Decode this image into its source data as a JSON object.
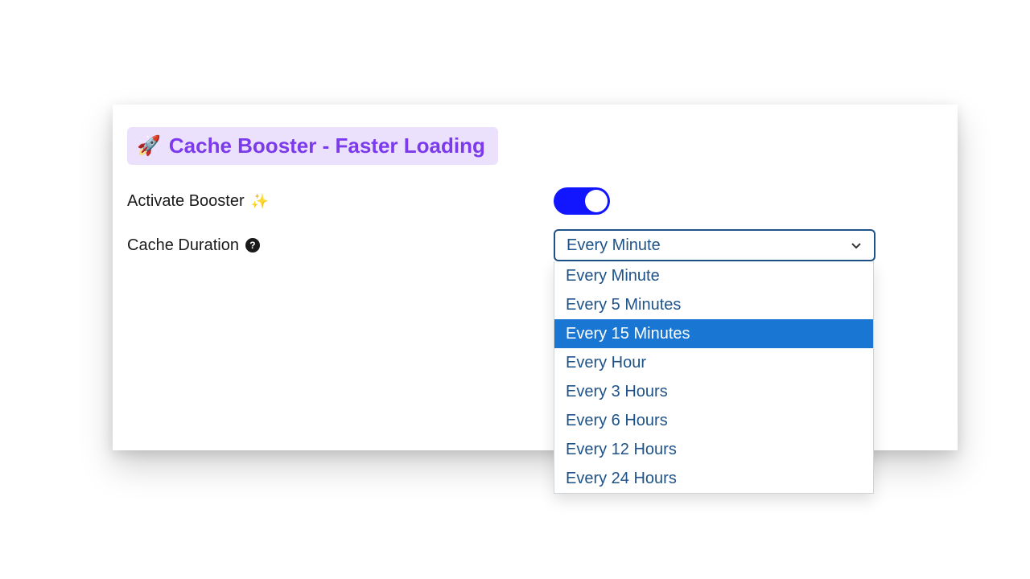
{
  "section": {
    "icon": "🚀",
    "title": "Cache Booster - Faster Loading"
  },
  "rows": {
    "activate": {
      "label": "Activate Booster",
      "sparkle": "✨",
      "toggle_on": true
    },
    "duration": {
      "label": "Cache Duration",
      "selected": "Every Minute",
      "options": [
        "Every Minute",
        "Every 5 Minutes",
        "Every 15 Minutes",
        "Every Hour",
        "Every 3 Hours",
        "Every 6 Hours",
        "Every 12 Hours",
        "Every 24 Hours"
      ],
      "highlighted_index": 2
    }
  },
  "colors": {
    "accent": "#7c3aed",
    "toggle": "#1216ff",
    "select_border": "#1e5288",
    "highlight": "#1976d2"
  }
}
